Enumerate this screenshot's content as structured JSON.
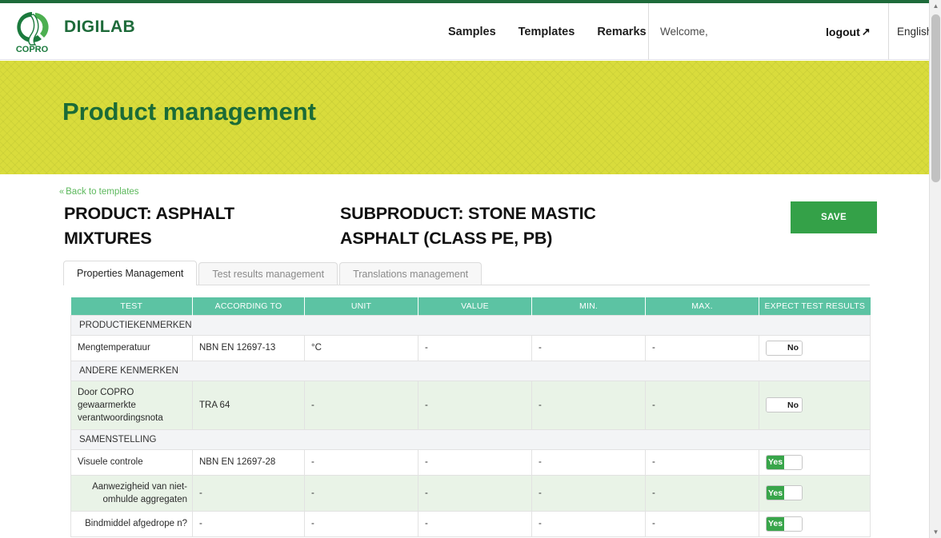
{
  "header": {
    "brand": "DIGILAB",
    "logo_caption": "COPRO",
    "nav": [
      {
        "label": "Samples"
      },
      {
        "label": "Templates"
      },
      {
        "label": "Remarks"
      }
    ],
    "welcome": "Welcome,",
    "logout": "logout",
    "logout_arrow": "↗",
    "language": "English",
    "language_caret": "▾"
  },
  "banner": {
    "title": "Product management",
    "color": "#d9dc3c",
    "title_color": "#1b6b37"
  },
  "content": {
    "back_link": "Back to templates",
    "back_chevron": "«",
    "product_title": "PRODUCT: ASPHALT MIXTURES",
    "subproduct_title": "SUBPRODUCT: STONE MASTIC ASPHALT (CLASS PE, PB)",
    "save_label": "SAVE",
    "save_color": "#34a148"
  },
  "tabs": [
    {
      "label": "Properties Management",
      "active": true
    },
    {
      "label": "Test results management",
      "active": false
    },
    {
      "label": "Translations management",
      "active": false
    }
  ],
  "table": {
    "header_color": "#5cc3a3",
    "columns": [
      "TEST",
      "ACCORDING TO",
      "UNIT",
      "VALUE",
      "MIN.",
      "MAX.",
      "EXPECT TEST RESULTS"
    ],
    "rows": [
      {
        "kind": "group",
        "label": "PRODUCTIEKENMERKEN"
      },
      {
        "kind": "data",
        "alt": false,
        "align": "left",
        "test": "Mengtemperatuur",
        "according_to": "NBN EN 12697-13",
        "unit": "°C",
        "value": "-",
        "min": "-",
        "max": "-",
        "expect": {
          "state": "off",
          "label": "No"
        }
      },
      {
        "kind": "group",
        "label": "ANDERE KENMERKEN"
      },
      {
        "kind": "data",
        "alt": true,
        "align": "left",
        "test": "Door COPRO gewaarmerkte verantwoordingsnota",
        "according_to": "TRA 64",
        "unit": "-",
        "value": "-",
        "min": "-",
        "max": "-",
        "expect": {
          "state": "off",
          "label": "No"
        }
      },
      {
        "kind": "group",
        "label": "SAMENSTELLING"
      },
      {
        "kind": "data",
        "alt": false,
        "align": "left",
        "test": "Visuele controle",
        "according_to": "NBN EN 12697-28",
        "unit": "-",
        "value": "-",
        "min": "-",
        "max": "-",
        "expect": {
          "state": "on",
          "label": "Yes"
        }
      },
      {
        "kind": "data",
        "alt": true,
        "align": "right",
        "test": "Aanwezigheid van niet-omhulde aggregaten",
        "according_to": "-",
        "unit": "-",
        "value": "-",
        "min": "-",
        "max": "-",
        "expect": {
          "state": "on",
          "label": "Yes"
        }
      },
      {
        "kind": "data",
        "alt": false,
        "align": "right",
        "test": "Bindmiddel afgedrope n?",
        "according_to": "-",
        "unit": "-",
        "value": "-",
        "min": "-",
        "max": "-",
        "expect": {
          "state": "on",
          "label": "Yes"
        }
      }
    ]
  },
  "scrollbar": {
    "up": "▲",
    "down": "▼"
  }
}
